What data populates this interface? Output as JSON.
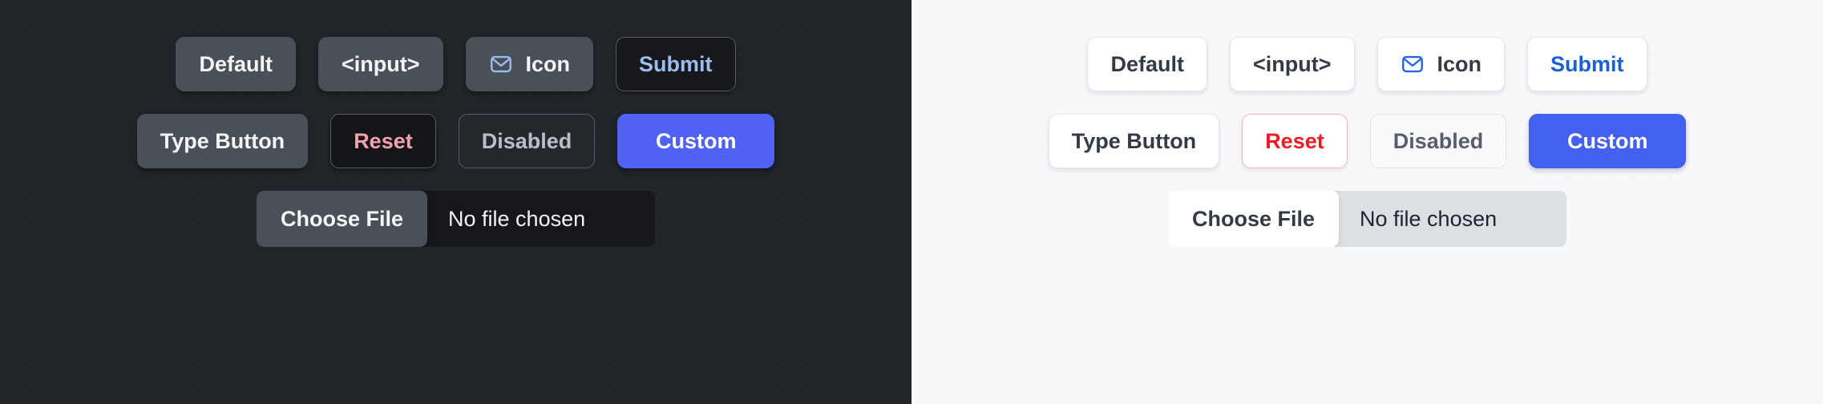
{
  "panels": [
    {
      "theme": "dark",
      "background_color": "#212429",
      "rows": [
        {
          "buttons": [
            {
              "label": "Default",
              "variant": "d-solid",
              "icon": null
            },
            {
              "label": "<input>",
              "variant": "d-solid",
              "icon": null
            },
            {
              "label": "Icon",
              "variant": "d-solid",
              "icon": "mail-icon",
              "icon_color": "#9dbdf0"
            },
            {
              "label": "Submit",
              "variant": "d-submit",
              "icon": null
            }
          ]
        },
        {
          "buttons": [
            {
              "label": "Type Button",
              "variant": "d-solid",
              "icon": null
            },
            {
              "label": "Reset",
              "variant": "d-reset",
              "icon": null
            },
            {
              "label": "Disabled",
              "variant": "d-disabled",
              "icon": null
            },
            {
              "label": "Custom",
              "variant": "d-custom",
              "icon": null
            }
          ]
        }
      ],
      "file_input": {
        "button_label": "Choose File",
        "status_text": "No file chosen",
        "track_color": "#15171b",
        "button_color": "#4a5058"
      }
    },
    {
      "theme": "light",
      "background_color": "#f7f8fa",
      "rows": [
        {
          "buttons": [
            {
              "label": "Default",
              "variant": "l-solid",
              "icon": null
            },
            {
              "label": "<input>",
              "variant": "l-solid",
              "icon": null
            },
            {
              "label": "Icon",
              "variant": "l-solid",
              "icon": "mail-icon",
              "icon_color": "#2563eb"
            },
            {
              "label": "Submit",
              "variant": "l-submit",
              "icon": null
            }
          ]
        },
        {
          "buttons": [
            {
              "label": "Type Button",
              "variant": "l-solid",
              "icon": null
            },
            {
              "label": "Reset",
              "variant": "l-reset",
              "icon": null
            },
            {
              "label": "Disabled",
              "variant": "l-disabled",
              "icon": null
            },
            {
              "label": "Custom",
              "variant": "l-custom",
              "icon": null
            }
          ]
        }
      ],
      "file_input": {
        "button_label": "Choose File",
        "status_text": "No file chosen",
        "track_color": "#dcdfe3",
        "button_color": "#ffffff"
      }
    }
  ],
  "colors": {
    "dark_background": "#212429",
    "light_background": "#f7f8fa",
    "dark_button_fill": "#4a5058",
    "accent_blue": "#4f62f5",
    "light_accent_blue": "#4460ee",
    "submit_text_dark": "#9dbdf0",
    "submit_text_light": "#1860d4",
    "reset_text_dark": "#f5a0ac",
    "reset_text_light": "#ee1c25",
    "reset_border_light": "#f8b4bb",
    "mail_icon_dark": "#9dbdf0",
    "mail_icon_light": "#2563eb"
  }
}
